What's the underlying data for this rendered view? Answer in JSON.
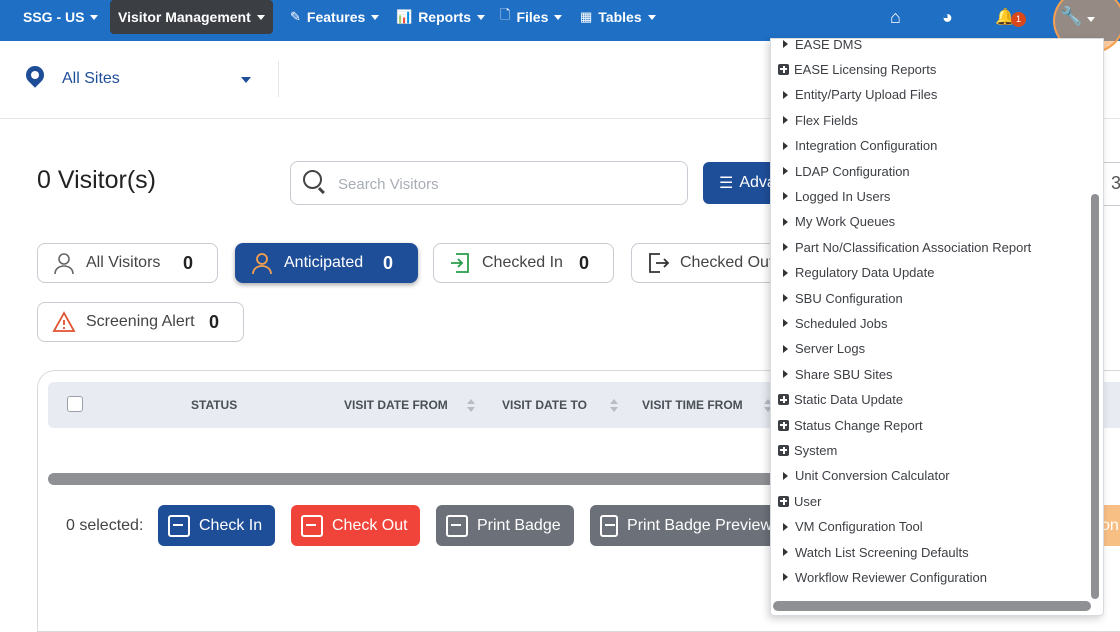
{
  "nav": {
    "items": [
      {
        "label": "SSG - US",
        "icon": ""
      },
      {
        "label": "Visitor Management",
        "icon": ""
      },
      {
        "label": "Features",
        "icon": "✎"
      },
      {
        "label": "Reports",
        "icon": "📊"
      },
      {
        "label": "Files",
        "icon": "🗋"
      },
      {
        "label": "Tables",
        "icon": "▦"
      }
    ],
    "icons": {
      "home": "⌂",
      "dashboard": "◕",
      "bell": "🔔",
      "wrench": "🔧"
    },
    "bell_count": "1",
    "color": "#1f6fc4"
  },
  "site": {
    "label": "All Sites"
  },
  "page": {
    "title": "0 Visitor(s)"
  },
  "search": {
    "placeholder": "Search Visitors",
    "value": ""
  },
  "advanced_button": {
    "icon": "☰",
    "label": "Adva"
  },
  "right_stub": "3",
  "filters": [
    {
      "label": "All Visitors",
      "count": "0",
      "icon": "person-icon"
    },
    {
      "label": "Anticipated",
      "count": "0",
      "icon": "person-icon",
      "active": true
    },
    {
      "label": "Checked In",
      "count": "0",
      "icon": "check-in-icon"
    },
    {
      "label": "Checked Out",
      "count": "",
      "icon": "check-out-icon"
    },
    {
      "label": "Screening Alert",
      "count": "0",
      "icon": "warning-icon"
    }
  ],
  "table": {
    "columns": [
      "STATUS",
      "VISIT DATE FROM",
      "VISIT DATE TO",
      "VISIT TIME FROM"
    ]
  },
  "actions": {
    "selected": "0 selected:",
    "buttons": [
      {
        "label": "Check In",
        "color": "#1f4e99"
      },
      {
        "label": "Check Out",
        "color": "#f0443a"
      },
      {
        "label": "Print Badge",
        "color": "#6c7078"
      },
      {
        "label": "Print Badge Preview",
        "color": "#6c7078"
      }
    ],
    "stub": "on"
  },
  "menu": {
    "items": [
      {
        "label": "EASE DMS",
        "icon": "arrow"
      },
      {
        "label": "EASE Licensing Reports",
        "icon": "plus"
      },
      {
        "label": "Entity/Party Upload Files",
        "icon": "arrow"
      },
      {
        "label": "Flex Fields",
        "icon": "arrow"
      },
      {
        "label": "Integration Configuration",
        "icon": "arrow"
      },
      {
        "label": "LDAP Configuration",
        "icon": "arrow"
      },
      {
        "label": "Logged In Users",
        "icon": "arrow"
      },
      {
        "label": "My Work Queues",
        "icon": "arrow"
      },
      {
        "label": "Part No/Classification Association Report",
        "icon": "arrow"
      },
      {
        "label": "Regulatory Data Update",
        "icon": "arrow"
      },
      {
        "label": "SBU Configuration",
        "icon": "arrow"
      },
      {
        "label": "Scheduled Jobs",
        "icon": "arrow"
      },
      {
        "label": "Server Logs",
        "icon": "arrow"
      },
      {
        "label": "Share SBU Sites",
        "icon": "arrow"
      },
      {
        "label": "Static Data Update",
        "icon": "plus"
      },
      {
        "label": "Status Change Report",
        "icon": "plus"
      },
      {
        "label": "System",
        "icon": "plus"
      },
      {
        "label": "Unit Conversion Calculator",
        "icon": "arrow"
      },
      {
        "label": "User",
        "icon": "plus"
      },
      {
        "label": "VM Configuration Tool",
        "icon": "arrow"
      },
      {
        "label": "Watch List Screening Defaults",
        "icon": "arrow"
      },
      {
        "label": "Workflow Reviewer Configuration",
        "icon": "arrow"
      }
    ]
  }
}
